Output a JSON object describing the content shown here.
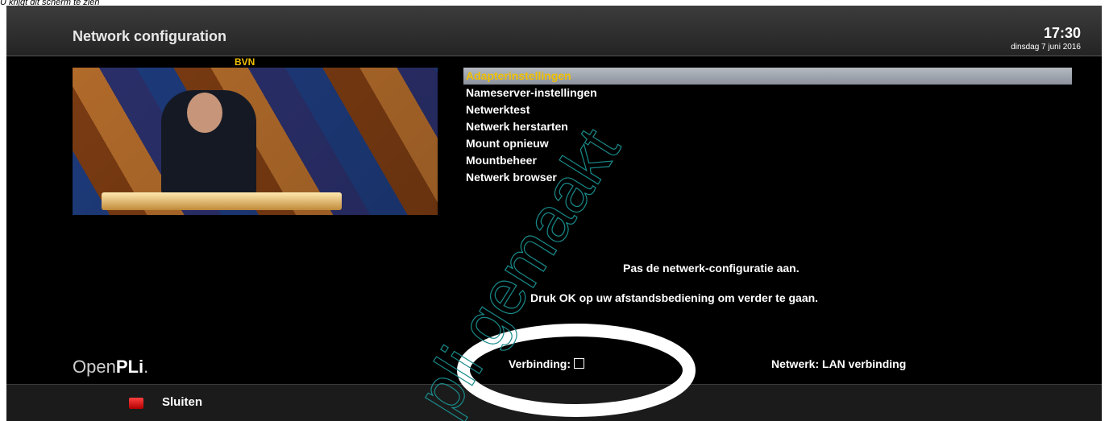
{
  "caption": "U krijgt dit scherm te zien",
  "header": {
    "title": "Network configuration",
    "time": "17:30",
    "date": "dinsdag 7 juni 2016"
  },
  "preview": {
    "channel": "BVN"
  },
  "menu": {
    "items": [
      {
        "label": "Adapterinstellingen",
        "selected": true
      },
      {
        "label": "Nameserver-instellingen"
      },
      {
        "label": "Netwerktest"
      },
      {
        "label": "Netwerk herstarten"
      },
      {
        "label": "Mount opnieuw"
      },
      {
        "label": "Mountbeheer"
      },
      {
        "label": "Netwerk browser"
      }
    ]
  },
  "info": {
    "line1": "Pas de netwerk-configuratie aan.",
    "line2": "Druk OK op uw afstandsbediening om verder te gaan."
  },
  "status": {
    "logo_prefix": "Open",
    "logo_bold": "PLi",
    "logo_suffix": ".",
    "verbinding_label": "Verbinding:",
    "netwerk_label": "Netwerk: LAN verbinding"
  },
  "footer": {
    "close_label": "Sluiten"
  },
  "watermark": "pli gemaakt",
  "colors": {
    "accent": "#f0c000",
    "red_key": "#e02020",
    "watermark": "#1a8a8a"
  }
}
